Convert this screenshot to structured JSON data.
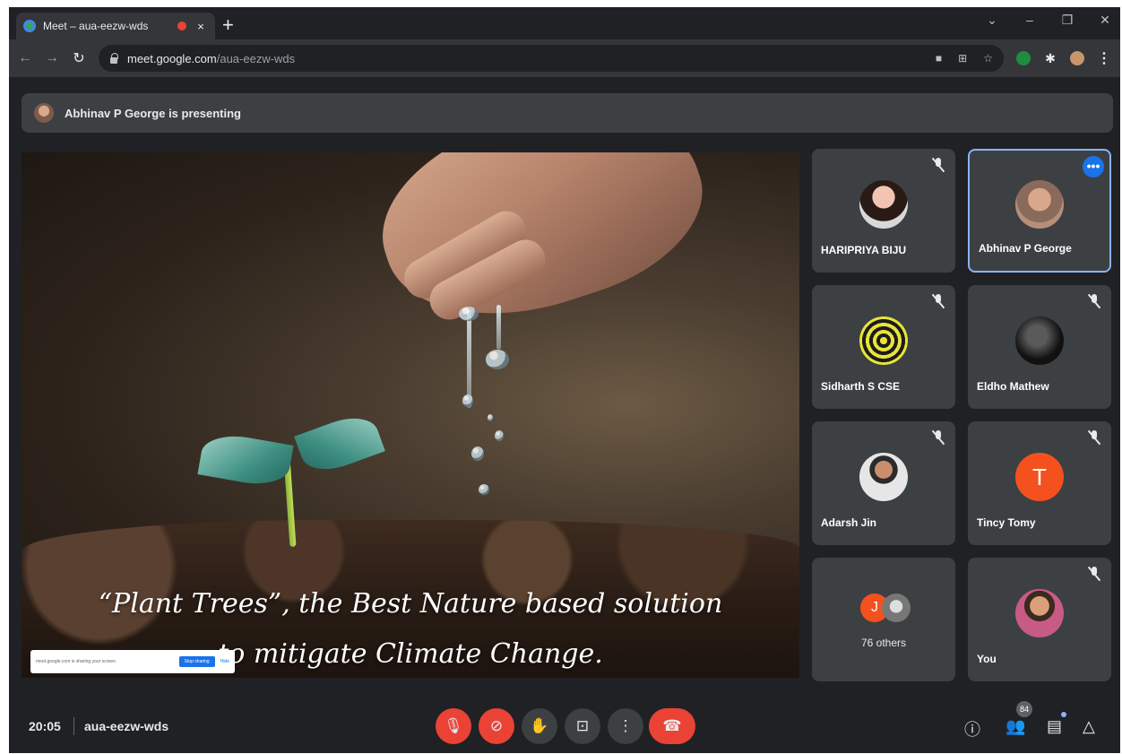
{
  "browser": {
    "tab_title": "Meet – aua-eezw-wds",
    "tab_close": "×",
    "new_tab": "+",
    "url_host": "meet.google.com",
    "url_path": "/aua-eezw-wds",
    "window_controls": [
      "⌄",
      "–",
      "❐",
      "✕"
    ]
  },
  "presenting_bar": {
    "text": "Abhinav P George is presenting"
  },
  "slide": {
    "line1": "“Plant Trees”, the Best Nature based solution",
    "line2": "to mitigate Climate Change.",
    "share_notice": "meet.google.com is sharing your screen.",
    "share_stop": "Stop sharing",
    "share_hide": "Hide"
  },
  "participants": [
    {
      "name": "HARIPRIYA BIJU",
      "muted": true,
      "icon": "user-photo"
    },
    {
      "name": "Abhinav P George",
      "muted": false,
      "active": true,
      "icon": "user-photo"
    },
    {
      "name": "Sidharth S CSE",
      "muted": true,
      "icon": "user-photo"
    },
    {
      "name": "Eldho Mathew",
      "muted": true,
      "icon": "user-photo"
    },
    {
      "name": "Adarsh Jin",
      "muted": true,
      "icon": "user-photo"
    },
    {
      "name": "Tincy Tomy",
      "muted": true,
      "initial": "T",
      "avatar_color": "#f4511e"
    },
    {
      "others_label": "76 others",
      "initial": "J",
      "avatar_color": "#f4511e"
    },
    {
      "name": "You",
      "muted": true,
      "icon": "user-photo"
    }
  ],
  "bottom_bar": {
    "time": "20:05",
    "meeting_code": "aua-eezw-wds",
    "people_count": "84",
    "controls": [
      "mic-off-icon",
      "camera-off-icon",
      "raise-hand-icon",
      "present-icon",
      "more-options-icon",
      "hang-up-icon"
    ],
    "right_icons": [
      "info-icon",
      "people-icon",
      "chat-icon",
      "activities-icon"
    ]
  },
  "colors": {
    "background": "#202124",
    "tile": "#3c4043",
    "accent_red": "#ea4335",
    "accent_blue": "#1a73e8"
  }
}
